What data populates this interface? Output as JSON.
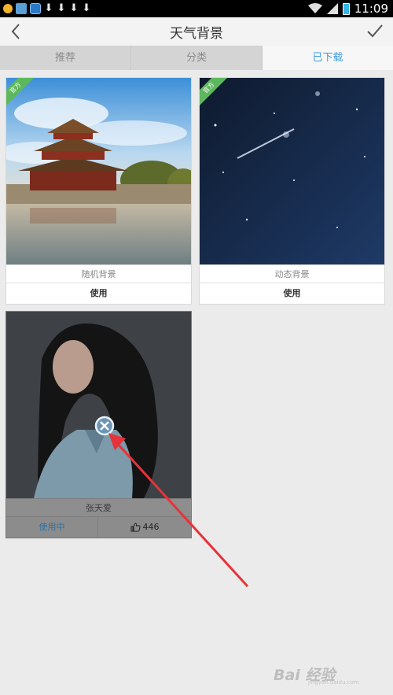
{
  "status_bar": {
    "time": "11:09",
    "left_icons": [
      "weather-icon",
      "app-icon",
      "download-icon",
      "download-icon",
      "download-icon",
      "download-icon"
    ],
    "download_glyph": "⬇"
  },
  "title_bar": {
    "title": "天气背景",
    "back_icon": "back-arrow-icon",
    "confirm_icon": "checkmark-icon"
  },
  "tabs": [
    {
      "label": "推荐",
      "active": false
    },
    {
      "label": "分类",
      "active": false
    },
    {
      "label": "已下载",
      "active": true
    }
  ],
  "cards": [
    {
      "badge": "官方",
      "name": "随机背景",
      "action": "使用"
    },
    {
      "badge": "官方",
      "name": "动态背景",
      "action": "使用"
    },
    {
      "name": "张天爱",
      "status": "使用中",
      "likes": "446"
    }
  ],
  "watermark": {
    "text": "Bai 经验",
    "sub": "jingyan.baidu.com"
  },
  "colors": {
    "accent": "#3a9cdb",
    "badge": "#5db85d",
    "annotation_arrow": "#e8323a"
  }
}
